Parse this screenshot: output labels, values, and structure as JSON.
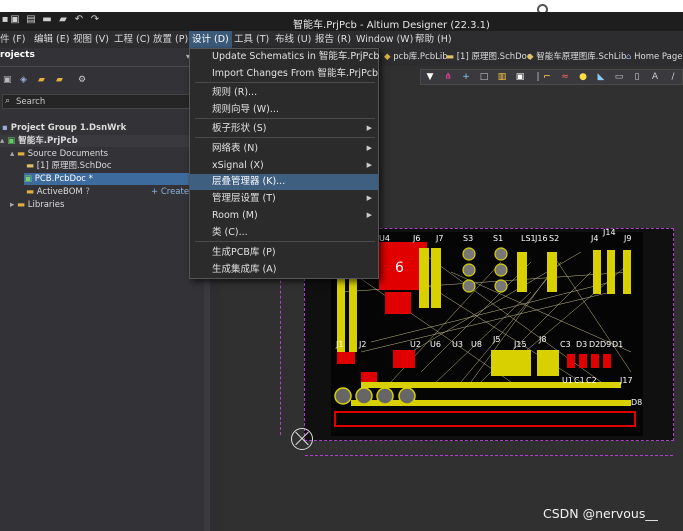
{
  "title": "智能车.PrjPcb - Altium Designer (22.3.1)",
  "menu": [
    "件 (F)",
    "编辑 (E)",
    "视图 (V)",
    "工程 (C)",
    "放置 (P)",
    "设计 (D)",
    "工具 (T)",
    "布线 (U)",
    "报告 (R)",
    "Window (W)",
    "帮助 (H)"
  ],
  "tabs": [
    "pcb库.PcbLib",
    "[1] 原理图.SchDoc",
    "智能车原理图库.SchLib",
    "Home Page"
  ],
  "panel": {
    "title": "rojects",
    "search_placeholder": "Search",
    "tree": [
      {
        "label": "Project Group 1.DsnWrk",
        "bold": true
      },
      {
        "label": "智能车.PrjPcb",
        "bold": true
      },
      {
        "label": "Source Documents",
        "bold": false
      },
      {
        "label": "[1] 原理图.SchDoc",
        "bold": false
      },
      {
        "label": "PCB.PcbDoc *",
        "bold": false
      },
      {
        "label": "ActiveBOM",
        "bold": false
      },
      {
        "label": "Libraries",
        "bold": false
      }
    ],
    "create_label": "+ Create"
  },
  "design_menu": [
    {
      "label": "Update Schematics in 智能车.PrjPcb",
      "arrow": false
    },
    {
      "label": "Import Changes From 智能车.PrjPcb",
      "arrow": false
    },
    {
      "label": "规则 (R)...",
      "arrow": false
    },
    {
      "label": "规则向导 (W)...",
      "arrow": false
    },
    {
      "label": "板子形状 (S)",
      "arrow": true
    },
    {
      "label": "网络表 (N)",
      "arrow": true
    },
    {
      "label": "xSignal (X)",
      "arrow": true
    },
    {
      "label": "层叠管理器 (K)...",
      "arrow": false
    },
    {
      "label": "管理层设置 (T)",
      "arrow": true
    },
    {
      "label": "Room (M)",
      "arrow": true
    },
    {
      "label": "类 (C)...",
      "arrow": false
    },
    {
      "label": "生成PCB库 (P)",
      "arrow": false
    },
    {
      "label": "生成集成库 (A)",
      "arrow": false
    }
  ],
  "board_labels": [
    "U4",
    "J6",
    "J7",
    "S3",
    "S1",
    "LS1",
    "J16",
    "S2",
    "J4",
    "J14",
    "J9",
    "J1",
    "J2",
    "U2",
    "U6",
    "U3",
    "U8",
    "J5",
    "J15",
    "J8",
    "C3",
    "D3",
    "D2",
    "D9",
    "D1",
    "J17",
    "U1",
    "C1",
    "C2",
    "D8",
    "6"
  ],
  "watermark": "CSDN @nervous__",
  "colors": {
    "accent_menu": "#3e5f80",
    "pad": "#d8d000",
    "copper": "#e00000"
  }
}
